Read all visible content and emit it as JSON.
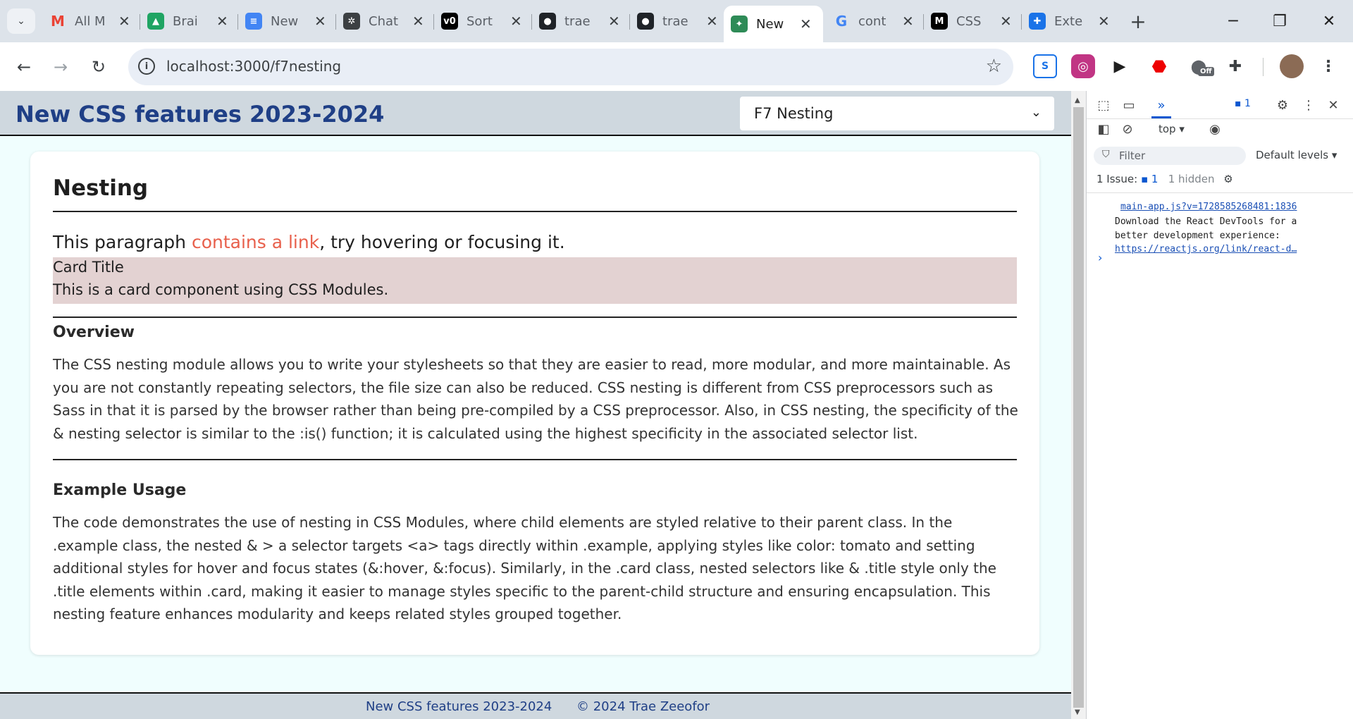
{
  "browser": {
    "tabs": [
      {
        "title": "All M",
        "icon": "gmail-icon",
        "color": "#ea4335",
        "glyph": "M"
      },
      {
        "title": "Brai",
        "icon": "google-drive-icon",
        "color": "#1fa463",
        "glyph": "▲"
      },
      {
        "title": "New",
        "icon": "google-docs-icon",
        "color": "#4285f4",
        "glyph": "≡"
      },
      {
        "title": "Chat",
        "icon": "chatgpt-icon",
        "color": "#3c4043",
        "glyph": "✲"
      },
      {
        "title": "Sort",
        "icon": "v0-icon",
        "color": "#000000",
        "glyph": "v0"
      },
      {
        "title": "trae",
        "icon": "github-icon",
        "color": "#1f2328",
        "glyph": "●"
      },
      {
        "title": "trae",
        "icon": "github-icon",
        "color": "#1f2328",
        "glyph": "●"
      },
      {
        "title": "New",
        "icon": "site-icon",
        "color": "#2e8b57",
        "glyph": "✦",
        "active": true
      },
      {
        "title": "cont",
        "icon": "google-icon",
        "color": "#4285f4",
        "glyph": "G"
      },
      {
        "title": "CSS",
        "icon": "mdn-icon",
        "color": "#000000",
        "glyph": "M"
      },
      {
        "title": "Exte",
        "icon": "extensions-icon",
        "color": "#1a73e8",
        "glyph": "✚"
      }
    ],
    "url": "localhost:3000/f7nesting",
    "extensions_badge": "Off"
  },
  "page": {
    "site_title": "New CSS features 2023-2024",
    "select_value": "F7 Nesting",
    "heading": "Nesting",
    "intro_before": "This paragraph ",
    "intro_link": "contains a link",
    "intro_after": ", try hovering or focusing it.",
    "demo_card_title": "Card Title",
    "demo_card_text": "This is a card component using CSS Modules.",
    "sections": [
      {
        "heading": "Overview",
        "text": "The CSS nesting module allows you to write your stylesheets so that they are easier to read, more modular, and more maintainable. As you are not constantly repeating selectors, the file size can also be reduced. CSS nesting is different from CSS preprocessors such as Sass in that it is parsed by the browser rather than being pre-compiled by a CSS preprocessor. Also, in CSS nesting, the specificity of the & nesting selector is similar to the :is() function; it is calculated using the highest specificity in the associated selector list."
      },
      {
        "heading": "Example Usage",
        "text": "The code demonstrates the use of nesting in CSS Modules, where child elements are styled relative to their parent class. In the .example class, the nested & > a selector targets <a> tags directly within .example, applying styles like color: tomato and setting additional styles for hover and focus states (&:hover, &:focus). Similarly, in the .card class, nested selectors like & .title style only the .title elements within .card, making it easier to manage styles specific to the parent-child structure and ensuring encapsulation. This nesting feature enhances modularity and keeps related styles grouped together."
      }
    ],
    "footer_title": "New CSS features 2023-2024",
    "footer_copyright": "© 2024 Trae Zeeofor"
  },
  "devtools": {
    "issues_badge": "1",
    "context": "top",
    "filter_placeholder": "Filter",
    "levels": "Default levels",
    "issues_label": "1 Issue:",
    "issues_count": "1",
    "hidden_label": "1 hidden",
    "log_source": "main-app.js?v=1728585268481:1836",
    "log_message": "Download the React DevTools for a\nbetter development experience:\n",
    "log_link": "https://reactjs.org/link/react-d…"
  },
  "colors": {
    "title_blue": "#1f3f86",
    "link_tomato": "#e8604c",
    "card_bg": "#e3d2d2",
    "page_bg": "#f0fefe"
  }
}
